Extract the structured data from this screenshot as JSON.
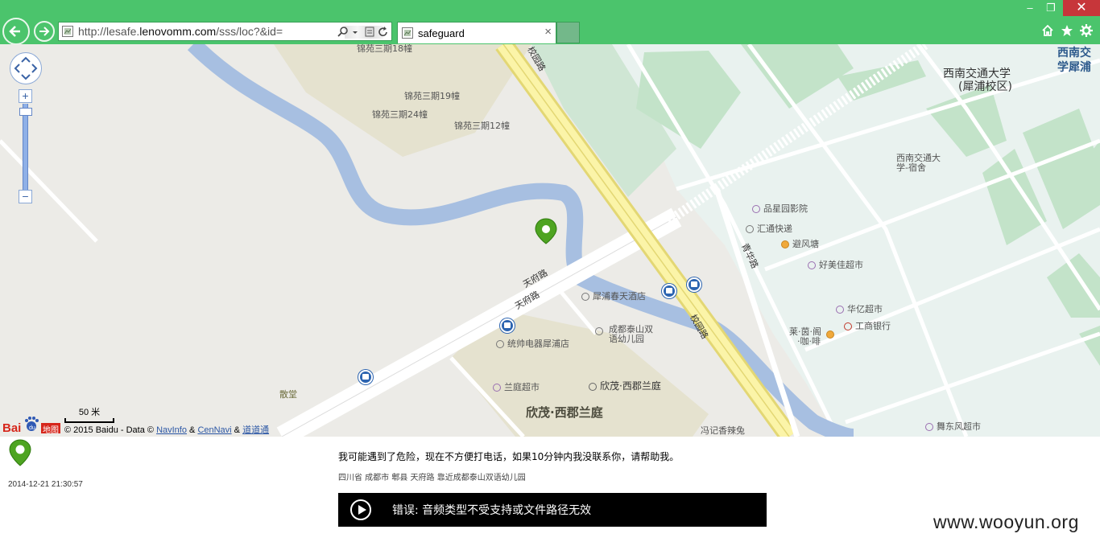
{
  "browser": {
    "url_prefix": "http://lesafe.",
    "url_domain": "lenovomm.com",
    "url_path": "/sss/loc?&id=",
    "tab_title": "safeguard",
    "tab_close": "×",
    "window_controls": {
      "minimize": "‒",
      "restore": "❐",
      "close": "✕"
    },
    "chrome_color": "#4bc46c"
  },
  "map": {
    "labels": {
      "jinyuan18": "锦苑三期18幢",
      "jinyuan19": "锦苑三期19幢",
      "jinyuan24": "锦苑三期24幢",
      "jinyuan12": "锦苑三期12幢",
      "xiaoyuan_road_1": "校园路",
      "xiaoyuan_road_2": "校园路",
      "tianfu_road_1": "天府路",
      "tianfu_road_2": "天府路",
      "qinghua_road": "青华路",
      "swjtu_1": "西南交通大学",
      "swjtu_2": "(犀浦校区)",
      "swjtu_edge_1": "西南交",
      "swjtu_edge_2": "学犀浦",
      "dorm_1": "西南交通大",
      "dorm_2": "学-宿舍",
      "cinema": "品星园影院",
      "express": "汇通快递",
      "bifengtang": "避风塘",
      "haomeijia": "好美佳超市",
      "huayi": "华亿超市",
      "icbc": "工商银行",
      "cafe_1": "莱·茵·阁",
      "cafe_2": "·咖·啡",
      "hotel": "犀浦春天酒店",
      "kindergarten_1": "成都泰山双",
      "kindergarten_2": "语幼儿园",
      "tongshuai": "统帅电器犀浦店",
      "lanting": "兰庭超市",
      "xinmao_small": "欣茂·西郡兰庭",
      "xinmao_big": "欣茂·西郡兰庭",
      "santang": "散堂",
      "fengji": "冯记香辣兔",
      "wudongfeng": "舞东风超市"
    },
    "zoom_in": "+",
    "zoom_out": "−",
    "scale_text": "50 米",
    "copyright_prefix": "© 2015 Baidu - Data © ",
    "link_navinfo": "NavInfo",
    "amp1": " & ",
    "link_cennavi": "CenNavi",
    "amp2": " & ",
    "link_daodaotong": "道道通",
    "logo_text": "Bai",
    "logo_text2": "地图"
  },
  "panel": {
    "timestamp": "2014-12-21 21:30:57",
    "message": "我可能遇到了危险，现在不方便打电话，如果10分钟内我没联系你，请帮助我。",
    "address": "四川省 成都市 郫县 天府路 靠近成都泰山双语幼儿园",
    "player_error": "错误: 音频类型不受支持或文件路径无效",
    "watermark": "www.wooyun.org"
  }
}
